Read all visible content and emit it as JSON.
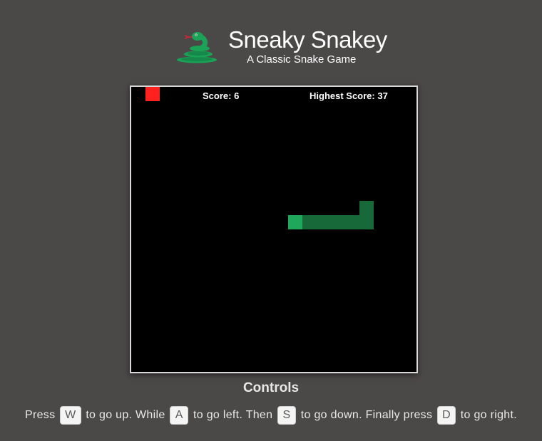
{
  "header": {
    "title": "Sneaky Snakey",
    "subtitle": "A Classic Snake Game",
    "logo_icon": "snake-logo-icon"
  },
  "game": {
    "score_text": "Score: 6",
    "high_score_text": "Highest Score: 37",
    "grid_cols": 20,
    "grid_rows": 20,
    "food": {
      "col": 1,
      "row": 0
    },
    "snake_head": {
      "col": 11,
      "row": 9
    },
    "snake_body": [
      {
        "col": 12,
        "row": 9
      },
      {
        "col": 13,
        "row": 9
      },
      {
        "col": 14,
        "row": 9
      },
      {
        "col": 15,
        "row": 9
      },
      {
        "col": 16,
        "row": 9
      },
      {
        "col": 16,
        "row": 8
      }
    ],
    "colors": {
      "background": "#000000",
      "food": "#ff2020",
      "snake_head": "#1fa85c",
      "snake_body": "#17693a"
    }
  },
  "controls": {
    "title": "Controls",
    "seg1": "Press",
    "key_up": "W",
    "seg2": "to go up. While",
    "key_left": "A",
    "seg3": "to go left. Then",
    "key_down": "S",
    "seg4": "to go down. Finally press",
    "key_right": "D",
    "seg5": "to go right."
  }
}
